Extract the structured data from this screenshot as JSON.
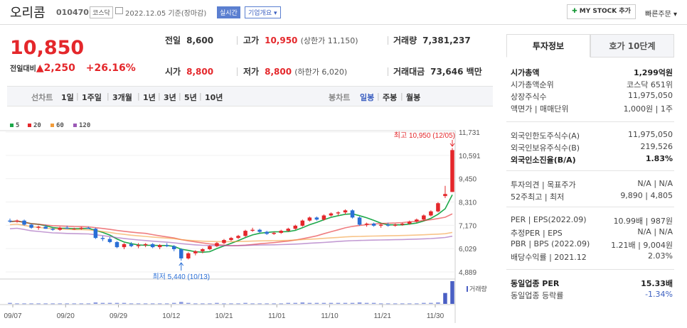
{
  "header": {
    "name": "오리콤",
    "code": "010470",
    "market": "코스닥",
    "date_text": "2022.12.05 기준(장마감)",
    "realtime": "실시간",
    "company_info": "기업개요",
    "mystock": "MY STOCK 추가",
    "quick_order": "빠른주문"
  },
  "quote": {
    "price": "10,850",
    "change_label": "전일대비",
    "change": "2,250",
    "change_pct": "+26.16%",
    "prev_label": "전일",
    "prev": "8,600",
    "high_label": "고가",
    "high": "10,950",
    "upper_limit": "(상한가 11,150)",
    "volume_label": "거래량",
    "volume": "7,381,237",
    "open_label": "시가",
    "open": "8,800",
    "low_label": "저가",
    "low": "8,800",
    "lower_limit": "(하한가 6,020)",
    "amount_label": "거래대금",
    "amount": "73,646 백만"
  },
  "period_bar": {
    "line_chart": "선차트",
    "periods": [
      "1일",
      "1주일",
      "3개월",
      "1년",
      "3년",
      "5년",
      "10년"
    ],
    "candle_chart": "봉차트",
    "candle_periods": [
      "일봉",
      "주봉",
      "월봉"
    ]
  },
  "legend": {
    "ma": [
      {
        "label": "5",
        "color": "#1da84a"
      },
      {
        "label": "20",
        "color": "#e4272b"
      },
      {
        "label": "60",
        "color": "#f39c3a"
      },
      {
        "label": "120",
        "color": "#9b59b6"
      }
    ]
  },
  "chart_data": {
    "type": "candlestick",
    "x_ticks": [
      "09/07",
      "09/20",
      "09/29",
      "10/12",
      "10/21",
      "11/01",
      "11/10",
      "11/21",
      "11/30"
    ],
    "y_ticks": [
      "11,731",
      "10,591",
      "9,450",
      "8,310",
      "7,170",
      "6,029",
      "4,889"
    ],
    "ylim": [
      4889,
      11731
    ],
    "max_annotation": "최고 10,950 (12/05)",
    "min_annotation": "최저 5,440 (10/13)",
    "volume_label": "거래량",
    "colors": {
      "up": "#e4272b",
      "down": "#2a6fd6"
    },
    "candles": [
      [
        7400,
        7500,
        7300,
        7350
      ],
      [
        7350,
        7450,
        7300,
        7400
      ],
      [
        7400,
        7450,
        7150,
        7200
      ],
      [
        7200,
        7250,
        7000,
        7050
      ],
      [
        7050,
        7150,
        6950,
        7100
      ],
      [
        7100,
        7200,
        7000,
        7000
      ],
      [
        7000,
        7050,
        6900,
        6950
      ],
      [
        6950,
        7100,
        6900,
        7050
      ],
      [
        7050,
        7150,
        7000,
        7000
      ],
      [
        7000,
        7050,
        6950,
        7000
      ],
      [
        7000,
        7100,
        6950,
        7050
      ],
      [
        7050,
        7100,
        7000,
        7000
      ],
      [
        7000,
        7050,
        6500,
        6550
      ],
      [
        6550,
        6650,
        6400,
        6500
      ],
      [
        6500,
        6600,
        6300,
        6350
      ],
      [
        6350,
        6400,
        6050,
        6100
      ],
      [
        6100,
        6300,
        6000,
        6250
      ],
      [
        6250,
        6350,
        6100,
        6150
      ],
      [
        6150,
        6300,
        6050,
        6200
      ],
      [
        6200,
        6300,
        6100,
        6250
      ],
      [
        6250,
        6300,
        6050,
        6100
      ],
      [
        6100,
        6250,
        6000,
        6200
      ],
      [
        6200,
        6300,
        6100,
        6150
      ],
      [
        6150,
        6200,
        5900,
        6000
      ],
      [
        6000,
        6050,
        5440,
        5550
      ],
      [
        5550,
        5850,
        5500,
        5800
      ],
      [
        5800,
        5950,
        5700,
        5900
      ],
      [
        5900,
        6050,
        5800,
        6000
      ],
      [
        6000,
        6200,
        5950,
        6150
      ],
      [
        6150,
        6350,
        6100,
        6300
      ],
      [
        6300,
        6500,
        6250,
        6450
      ],
      [
        6450,
        6600,
        6400,
        6550
      ],
      [
        6550,
        6700,
        6500,
        6650
      ],
      [
        6650,
        6950,
        6600,
        6900
      ],
      [
        6900,
        7050,
        6850,
        6950
      ],
      [
        6950,
        7000,
        6800,
        6850
      ],
      [
        6850,
        6900,
        6700,
        6750
      ],
      [
        6750,
        6850,
        6700,
        6800
      ],
      [
        6800,
        6950,
        6750,
        6900
      ],
      [
        6900,
        7050,
        6850,
        7000
      ],
      [
        7000,
        7200,
        6950,
        7150
      ],
      [
        7150,
        7450,
        7100,
        7400
      ],
      [
        7400,
        7600,
        7350,
        7550
      ],
      [
        7550,
        7600,
        7400,
        7450
      ],
      [
        7450,
        7700,
        7400,
        7650
      ],
      [
        7650,
        7800,
        7600,
        7750
      ],
      [
        7750,
        7850,
        7650,
        7800
      ],
      [
        7800,
        7950,
        7700,
        7900
      ],
      [
        7900,
        7950,
        7500,
        7550
      ],
      [
        7550,
        7600,
        7150,
        7200
      ],
      [
        7200,
        7300,
        7100,
        7250
      ],
      [
        7250,
        7300,
        7100,
        7150
      ],
      [
        7150,
        7250,
        7050,
        7200
      ],
      [
        7200,
        7300,
        7100,
        7150
      ],
      [
        7150,
        7250,
        7100,
        7200
      ],
      [
        7200,
        7300,
        7150,
        7250
      ],
      [
        7250,
        7400,
        7200,
        7350
      ],
      [
        7350,
        7500,
        7300,
        7450
      ],
      [
        7450,
        7700,
        7400,
        7650
      ],
      [
        7650,
        7900,
        7600,
        7850
      ],
      [
        7850,
        8300,
        7800,
        8250
      ],
      [
        8600,
        9100,
        8500,
        8700
      ],
      [
        8800,
        10950,
        8800,
        10850
      ]
    ],
    "volumes": [
      2,
      1,
      1,
      1,
      1,
      1,
      1,
      1,
      1,
      1,
      1,
      1,
      3,
      2,
      2,
      2,
      2,
      1,
      1,
      1,
      1,
      1,
      1,
      2,
      4,
      2,
      1,
      1,
      1,
      2,
      1,
      1,
      1,
      2,
      1,
      1,
      1,
      1,
      1,
      2,
      2,
      3,
      2,
      2,
      2,
      2,
      2,
      2,
      2,
      3,
      2,
      2,
      1,
      1,
      1,
      1,
      1,
      1,
      2,
      2,
      3,
      22,
      46
    ]
  },
  "side": {
    "tabs": [
      "투자정보",
      "호가 10단계"
    ],
    "rows1": [
      {
        "l": "시가총액",
        "r": "1,299억원",
        "bold": true
      },
      {
        "l": "시가총액순위",
        "r": "코스닥 651위"
      },
      {
        "l": "상장주식수",
        "r": "11,975,050"
      },
      {
        "l": "액면가 | 매매단위",
        "r": "1,000원 | 1주"
      }
    ],
    "rows2": [
      {
        "l": "외국인한도주식수(A)",
        "r": "11,975,050"
      },
      {
        "l": "외국인보유주식수(B)",
        "r": "219,526"
      },
      {
        "l": "외국인소진율(B/A)",
        "r": "1.83%",
        "bold": true
      }
    ],
    "rows3": [
      {
        "l": "투자의견 | 목표주가",
        "r": "N/A | N/A"
      },
      {
        "l": "52주최고 | 최저",
        "r": "9,890 | 4,805"
      }
    ],
    "rows4": [
      {
        "l": "PER | EPS(2022.09)",
        "r": "10.99배 | 987원"
      },
      {
        "l": "추정PER | EPS",
        "r": "N/A | N/A"
      },
      {
        "l": "PBR | BPS (2022.09)",
        "r": "1.21배 | 9,004원"
      },
      {
        "l": "배당수익률 | 2021.12",
        "r": "2.03%"
      }
    ],
    "rows5": [
      {
        "l": "동일업종 PER",
        "r": "15.33배",
        "bold": true
      },
      {
        "l": "동일업종 등락률",
        "r": "-1.34%",
        "blue": true
      }
    ]
  }
}
